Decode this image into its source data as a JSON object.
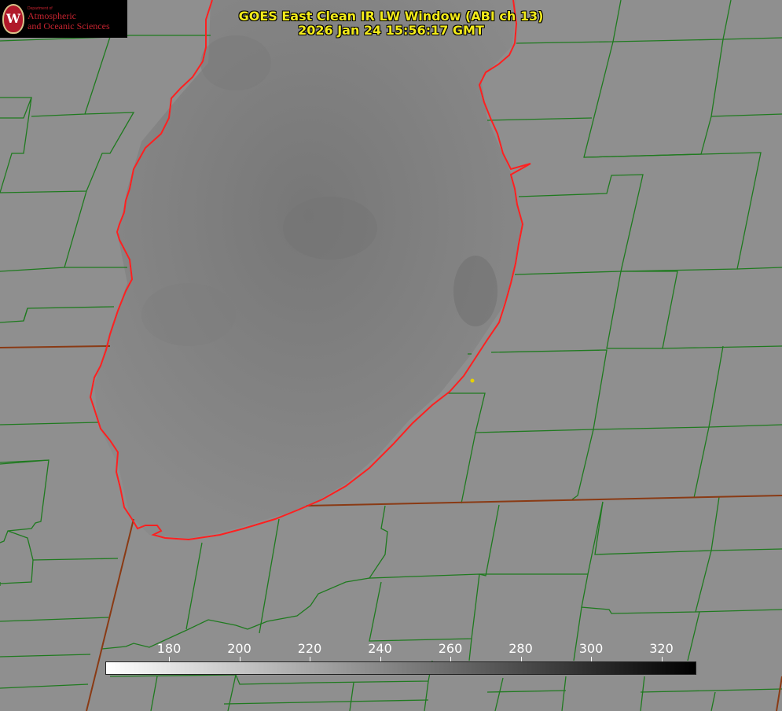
{
  "title": {
    "line1": "GOES East Clean IR LW Window (ABI ch 13)",
    "line2": "2026 Jan 24 15:56:17 GMT"
  },
  "logo": {
    "dept": "Department of",
    "line1": "Atmospheric",
    "line2": "and Oceanic Sciences",
    "seal_letter": "W"
  },
  "colorbar": {
    "ticks": [
      "180",
      "200",
      "220",
      "240",
      "260",
      "280",
      "300",
      "320"
    ],
    "gradient_from": "#ffffff",
    "gradient_to": "#000000"
  },
  "colors": {
    "background": "#8e8e8e",
    "county_lines": "#1f7a1f",
    "state_lines": "#8a3a14",
    "lake_outline": "#ff2020",
    "title_text": "#f2ea1a",
    "marker": "#e6d000"
  }
}
